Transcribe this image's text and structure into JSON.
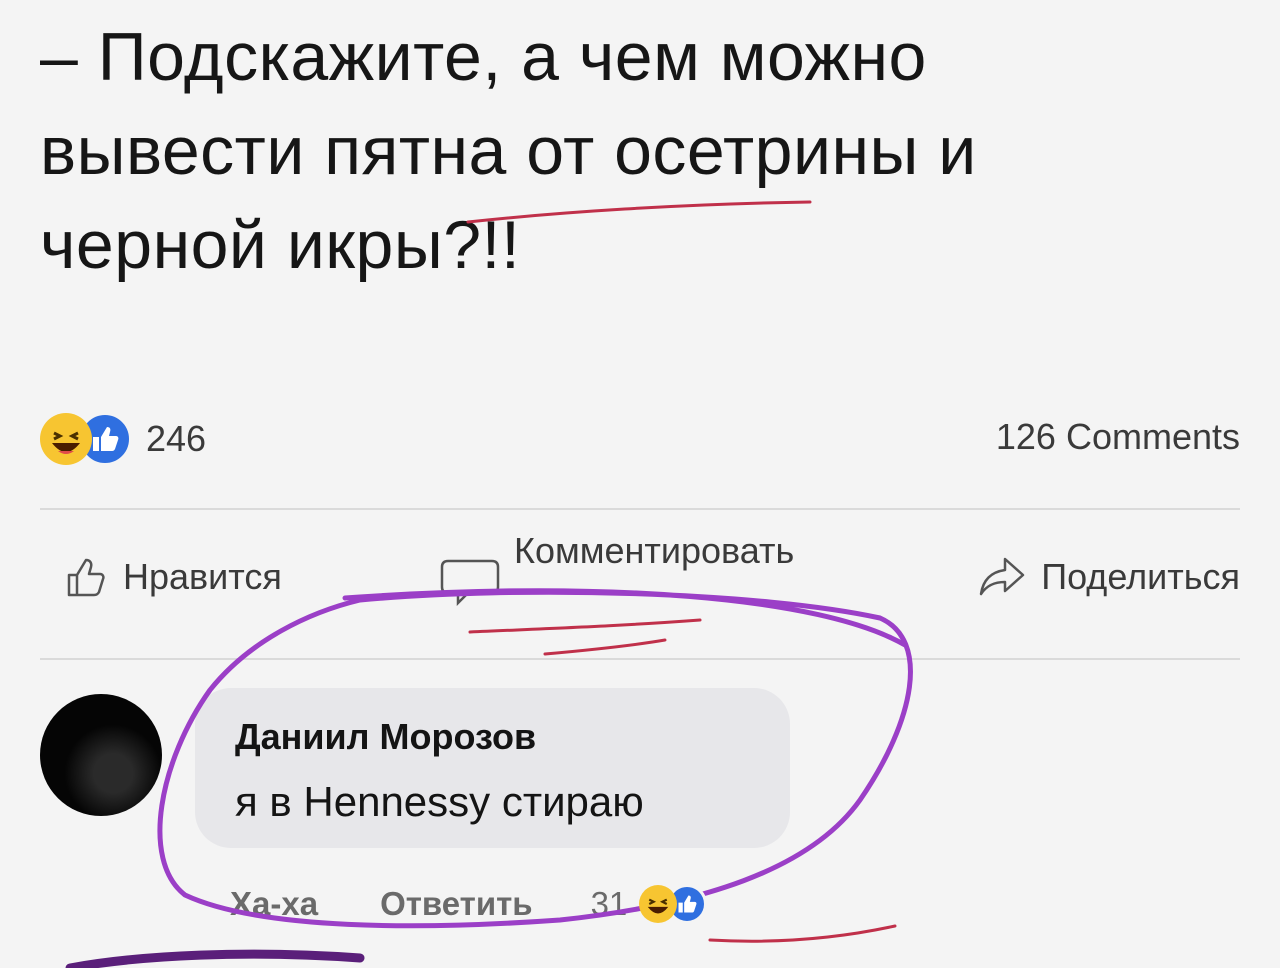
{
  "post": {
    "lines": [
      "– Подскажите, а чем можно",
      "вывести пятна от осетрины и",
      "черной икры?!!"
    ]
  },
  "stats": {
    "reaction_count": "246",
    "comments_label": "126 Comments"
  },
  "actions": {
    "like_label": "Нравится",
    "comment_label": "Комментировать",
    "share_label": "Поделиться"
  },
  "comment": {
    "author": "Даниил Морозов",
    "text": "я в Hennessy стираю",
    "haha_label": "Ха-ха",
    "reply_label": "Ответить",
    "reaction_count": "31"
  },
  "colors": {
    "annotation_red": "#c0304a",
    "annotation_purple": "#9b3fc7",
    "like_blue": "#2f6fe0",
    "haha_yellow": "#f7c531"
  }
}
